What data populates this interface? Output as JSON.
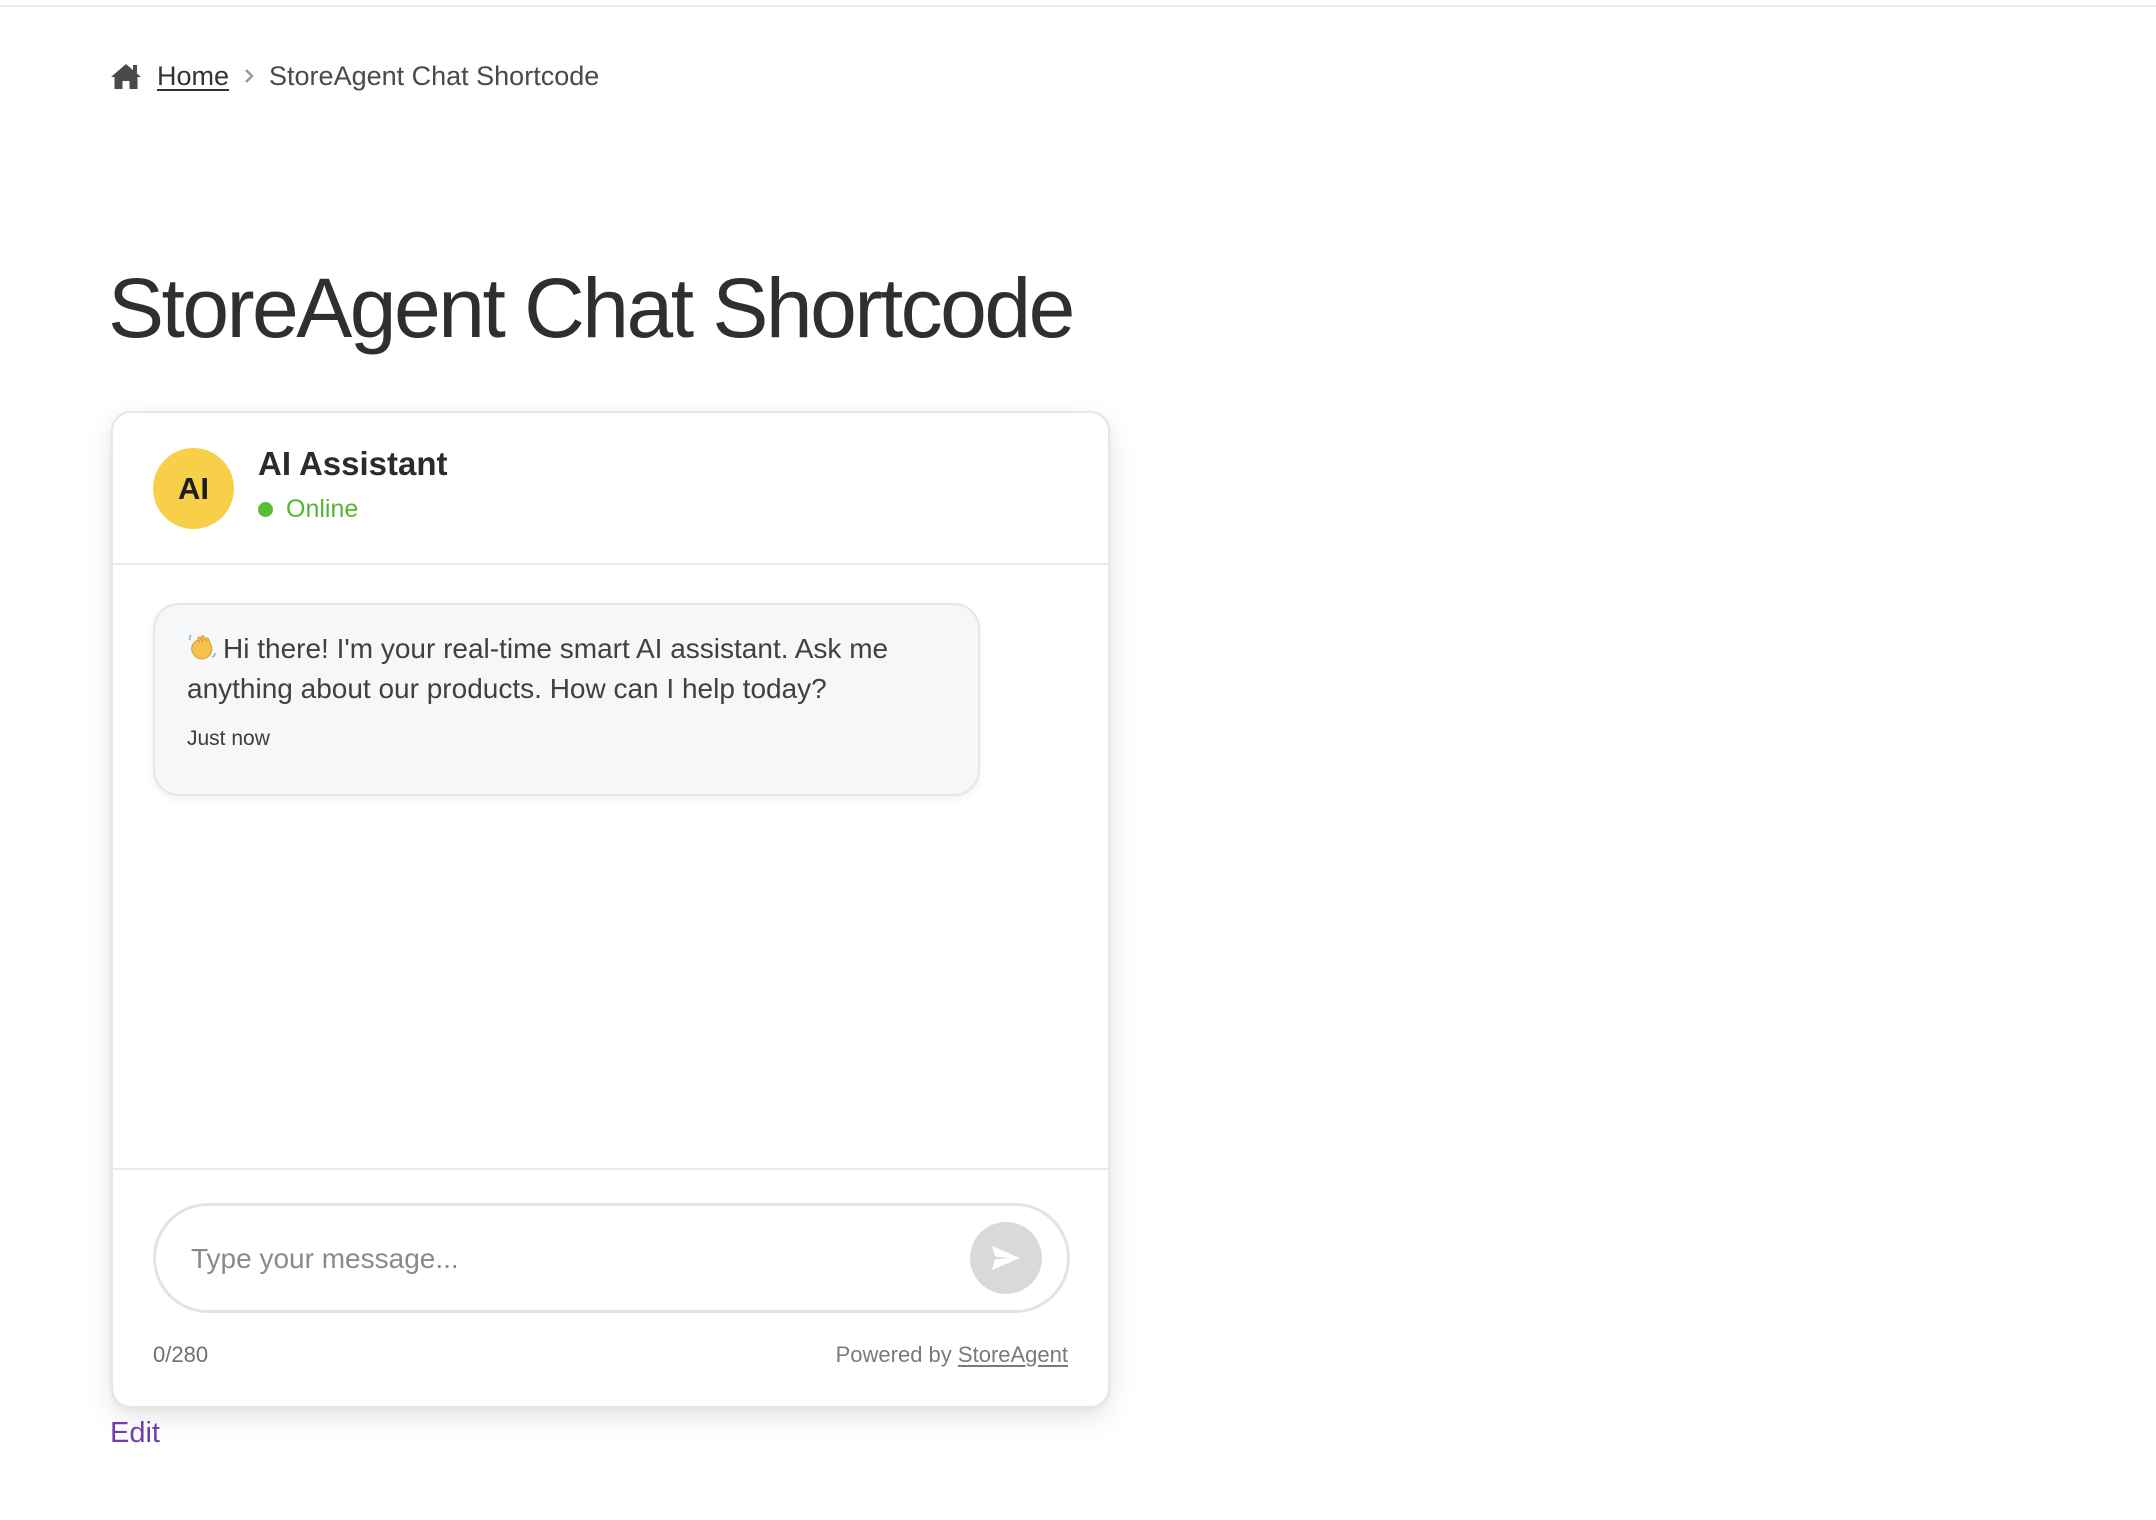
{
  "breadcrumb": {
    "home_icon": "home-icon",
    "home_label": "Home",
    "separator_icon": "chevron-right-icon",
    "current_label": "StoreAgent Chat Shortcode"
  },
  "page": {
    "title": "StoreAgent Chat Shortcode",
    "edit_label": "Edit"
  },
  "chat": {
    "header": {
      "avatar_text": "AI",
      "assistant_name": "AI Assistant",
      "status_text": "Online"
    },
    "messages": [
      {
        "icon": "waving-hand-icon",
        "text": "Hi there! I'm your real-time smart AI assistant. Ask me anything about our products. How can I help today?",
        "time": "Just now"
      }
    ],
    "composer": {
      "placeholder": "Type your message...",
      "value": "",
      "send_icon": "send-icon",
      "char_count": "0/280",
      "powered_prefix": "Powered by",
      "powered_link": "StoreAgent"
    }
  },
  "colors": {
    "avatar_bg": "#f8cf48",
    "online_green": "#57bf36",
    "edit_link": "#7040a8",
    "send_button_bg": "#d9d9d9"
  }
}
